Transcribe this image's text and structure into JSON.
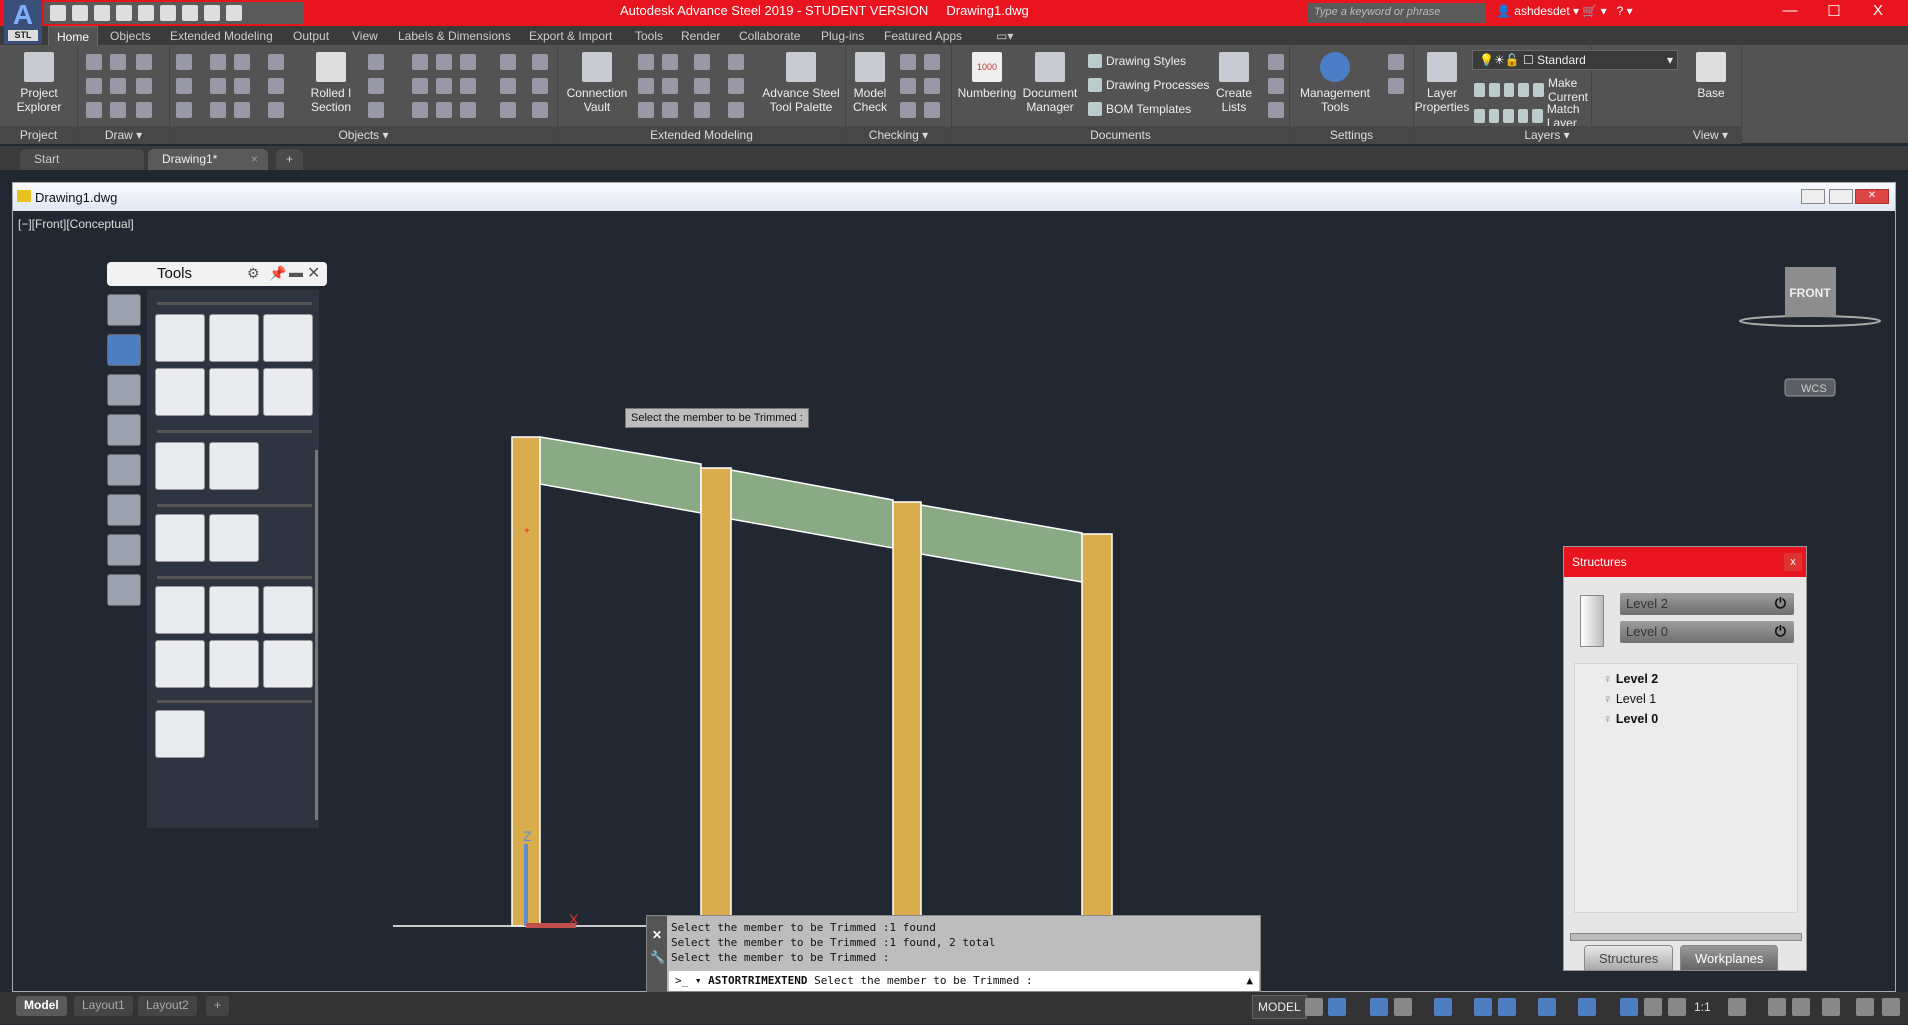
{
  "app": {
    "title": "Autodesk Advance Steel 2019 - STUDENT VERSION     Drawing1.dwg",
    "app_button": "A",
    "app_sub": "STL",
    "search_placeholder": "Type a keyword or phrase",
    "user": "ashdesdet",
    "minimize": "—",
    "maximize": "☐",
    "close": "X",
    "accent": "#e8141f"
  },
  "ribbon_tabs": [
    "Home",
    "Objects",
    "Extended Modeling",
    "Output",
    "View",
    "Labels & Dimensions",
    "Export & Import",
    "Tools",
    "Render",
    "Collaborate",
    "Plug-ins",
    "Featured Apps"
  ],
  "ribbon": {
    "panels": [
      "Project",
      "Draw ▾",
      "Objects ▾",
      "Extended Modeling",
      "Checking ▾",
      "Documents",
      "Settings",
      "Layers ▾",
      "View ▾"
    ],
    "project_explorer": "Project Explorer",
    "rolled_section": "Rolled I Section",
    "connection_vault": "Connection Vault",
    "tool_palette": "Advance Steel Tool Palette",
    "model_check": "Model Check",
    "numbering": "Numbering",
    "document_manager": "Document Manager",
    "drawing_styles": "Drawing Styles",
    "drawing_processes": "Drawing Processes",
    "bom_templates": "BOM Templates",
    "create_lists": "Create Lists",
    "management_tools": "Management Tools",
    "layer_properties": "Layer Properties",
    "layer_dropdown": "Standard",
    "make_current": "Make Current",
    "match_layer": "Match Layer",
    "base": "Base",
    "numbering_icon_text": "1000"
  },
  "file_tabs": [
    "Start",
    "Drawing1*"
  ],
  "document": {
    "title": "Drawing1.dwg",
    "view_label": "[−][Front][Conceptual]",
    "tooltip": "Select the member to be Trimmed :",
    "viewcube": "FRONT",
    "wcs": "WCS",
    "ucs_z": "Z",
    "ucs_x": "X"
  },
  "colors": {
    "column": "#d9ad4d",
    "beam": "#8aaa86",
    "viewport": "#222831"
  },
  "tools_palette": {
    "title": "Tools"
  },
  "structures": {
    "title": "Structures",
    "close": "x",
    "level_top": "Level 2",
    "level_bottom": "Level 0",
    "tree": [
      {
        "label": "Level 2",
        "bold": true
      },
      {
        "label": "Level 1",
        "bold": false
      },
      {
        "label": "Level 0",
        "bold": true
      }
    ],
    "tabs": [
      "Structures",
      "Workplanes"
    ]
  },
  "command_line": {
    "history": [
      "Select the member to be Trimmed :1 found",
      "Select the member to be Trimmed :1 found, 2 total",
      "Select the member to be Trimmed :"
    ],
    "command": "ASTORTRIMEXTEND",
    "prompt": "Select the member to be Trimmed :"
  },
  "status": {
    "layout_tabs": [
      "Model",
      "Layout1",
      "Layout2"
    ],
    "model": "MODEL",
    "scale": "1:1"
  }
}
